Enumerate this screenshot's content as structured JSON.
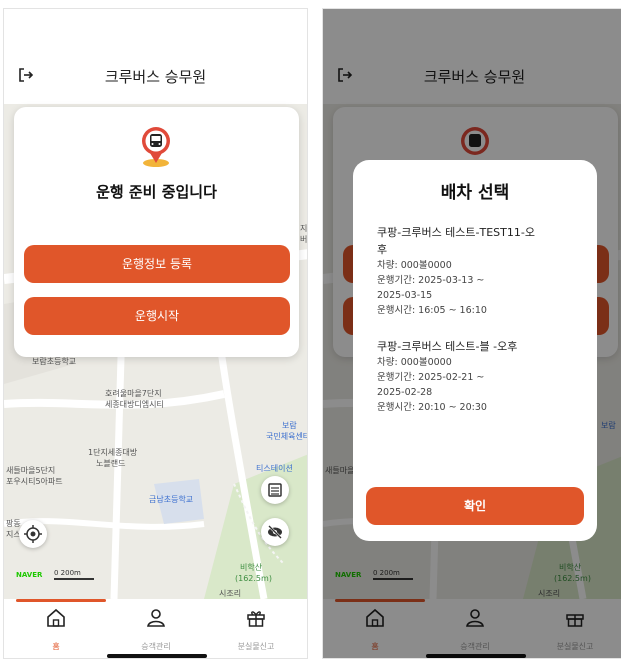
{
  "app": {
    "title": "크루버스 승무원"
  },
  "map": {
    "labels": [
      {
        "text": "보람초등학교",
        "cls": ""
      },
      {
        "text": "호려울마을7단지",
        "cls": ""
      },
      {
        "text": "세종대방디엠시티",
        "cls": ""
      },
      {
        "text": "1단지세종대방",
        "cls": ""
      },
      {
        "text": "노블랜드",
        "cls": ""
      },
      {
        "text": "새들마을5단지",
        "cls": ""
      },
      {
        "text": "포우시티5아파트",
        "cls": ""
      },
      {
        "text": "금남초등학교",
        "cls": "blue"
      },
      {
        "text": "보람",
        "cls": "blue"
      },
      {
        "text": "국민체육센터",
        "cls": "blue"
      },
      {
        "text": "티스테이션",
        "cls": "blue"
      },
      {
        "text": "비학산",
        "cls": "green"
      },
      {
        "text": "(162.5m)",
        "cls": "green"
      },
      {
        "text": "시조리",
        "cls": ""
      },
      {
        "text": "지",
        "cls": ""
      },
      {
        "text": "버",
        "cls": ""
      },
      {
        "text": "팡동",
        "cls": ""
      },
      {
        "text": "지스",
        "cls": ""
      }
    ],
    "naver": "NAVER",
    "scale": "0      200m"
  },
  "home": {
    "status_title": "운행 준비 중입니다",
    "register_button": "운행정보 등록",
    "start_button": "운행시작"
  },
  "tabs": [
    {
      "label": "홈",
      "icon": "home-icon",
      "active": true
    },
    {
      "label": "승객관리",
      "icon": "person-icon",
      "active": false
    },
    {
      "label": "분실물신고",
      "icon": "gift-icon",
      "active": false
    }
  ],
  "modal": {
    "title": "배차 선택",
    "dispatches": [
      {
        "name_line1": "쿠팡-크루버스 테스트-TEST11-오",
        "name_line2": "후",
        "vehicle": "차량: 000볼0000",
        "period_line1": "운행기간: 2025-03-13 ~",
        "period_line2": "2025-03-15",
        "time": "운행시간: 16:05 ~ 16:10"
      },
      {
        "name_line1": "쿠팡-크루버스 테스트-블       -오후",
        "vehicle": "차량: 000볼0000",
        "period_line1": "운행기간: 2025-02-21 ~",
        "period_line2": "2025-02-28",
        "time": "운행시간: 20:10 ~ 20:30"
      }
    ],
    "confirm_button": "확인"
  },
  "colors": {
    "accent": "#e0562a",
    "bus_red": "#e04a3a",
    "pin_gold": "#f2b43a"
  }
}
